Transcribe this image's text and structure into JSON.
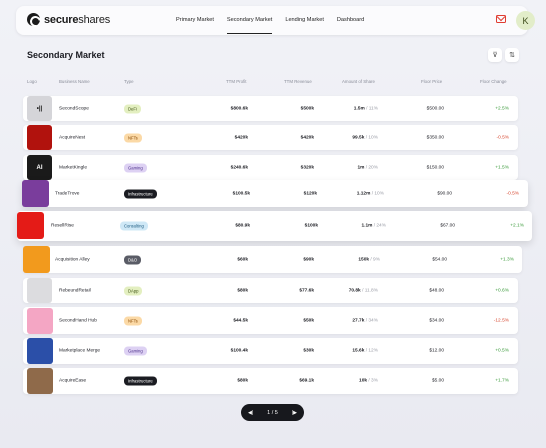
{
  "brand": {
    "name_bold": "secure",
    "name_rest": "shares"
  },
  "nav": {
    "items": [
      "Primary Market",
      "Secondary Market",
      "Lending Market",
      "Dashboard"
    ],
    "active": 1
  },
  "user": {
    "initial": "K"
  },
  "page": {
    "title": "Secondary Market"
  },
  "columns": [
    "Logo",
    "Business Name",
    "Type",
    "TTM Profit",
    "TTM Revenue",
    "Amount of Share",
    "Floor Price",
    "Floor Change"
  ],
  "rows": [
    {
      "name": "SecondScope",
      "type": "DeFi",
      "profit": "$800.6k",
      "revenue": "$500k",
      "shares": "1.5m",
      "shares_pct": "/ 11%",
      "price": "$500.00",
      "change": "+2.5%",
      "trend": "up",
      "badge_bg": "#e3efc0",
      "badge_fg": "#3e5212",
      "logo_bg": "#d5d5d9",
      "logo_icon": "text-mark",
      "logo_text": "•|| ",
      "logo_fg": "#111"
    },
    {
      "name": "AcquireNest",
      "type": "NFTs",
      "profit": "$420k",
      "revenue": "$420k",
      "shares": "99.5k",
      "shares_pct": "/ 10%",
      "price": "$350.00",
      "change": "-0.5%",
      "trend": "down",
      "badge_bg": "#fbd9a6",
      "badge_fg": "#8a4a05",
      "logo_bg": "#b1120d",
      "logo_icon": "red-swirl",
      "logo_text": "",
      "logo_fg": "#fff"
    },
    {
      "name": "MarketKingle",
      "type": "Gaming",
      "profit": "$240.6k",
      "revenue": "$320k",
      "shares": "1m",
      "shares_pct": "/ 20%",
      "price": "$150.00",
      "change": "+1.5%",
      "trend": "up",
      "badge_bg": "#ddd1f3",
      "badge_fg": "#4c2f8a",
      "logo_bg": "#1a1a1a",
      "logo_icon": "ai-mark",
      "logo_text": "AI",
      "logo_fg": "#fff"
    },
    {
      "name": "TradeTrove",
      "type": "Infrastructure",
      "profit": "$100.5k",
      "revenue": "$120k",
      "shares": "1.12m",
      "shares_pct": "/ 10%",
      "price": "$90.00",
      "change": "-0.5%",
      "trend": "down",
      "badge_bg": "#1b1c22",
      "badge_fg": "#ffffff",
      "logo_bg": "#7a3d9c",
      "logo_icon": "photo-mark",
      "logo_text": "",
      "logo_fg": "#fff"
    },
    {
      "name": "ResellRise",
      "type": "Consulting",
      "profit": "$80.9k",
      "revenue": "$100k",
      "shares": "1.1m",
      "shares_pct": "/ 24%",
      "price": "$67.00",
      "change": "+2.1%",
      "trend": "up",
      "badge_bg": "#cfe8f6",
      "badge_fg": "#1d5b80",
      "logo_bg": "#e41b17",
      "logo_icon": "flag-mark",
      "logo_text": "",
      "logo_fg": "#ffd800"
    },
    {
      "name": "Acquisition Alley",
      "type": "D&O",
      "profit": "$60k",
      "revenue": "$90k",
      "shares": "150k",
      "shares_pct": "/ 9%",
      "price": "$54.00",
      "change": "+1.3%",
      "trend": "up",
      "badge_bg": "#5a5c66",
      "badge_fg": "#ffffff",
      "logo_bg": "#f29a1d",
      "logo_icon": "orange-mark",
      "logo_text": "",
      "logo_fg": "#fff"
    },
    {
      "name": "RebeundRetail",
      "type": "DApp",
      "profit": "$80k",
      "revenue": "$77.6k",
      "shares": "70.8k",
      "shares_pct": "/ 11.8%",
      "price": "$48.00",
      "change": "+0.6%",
      "trend": "up",
      "badge_bg": "#e3efc0",
      "badge_fg": "#3e5212",
      "logo_bg": "#dcdcdf",
      "logo_icon": "wire-mark",
      "logo_text": "",
      "logo_fg": "#333"
    },
    {
      "name": "SecondHand Hub",
      "type": "NFTs",
      "profit": "$44.5k",
      "revenue": "$50k",
      "shares": "27.7k",
      "shares_pct": "/ 34%",
      "price": "$34.00",
      "change": "-12.5%",
      "trend": "down",
      "badge_bg": "#fbd9a6",
      "badge_fg": "#8a4a05",
      "logo_bg": "#f4a6c4",
      "logo_icon": "banana-mark",
      "logo_text": "",
      "logo_fg": "#e8b21a"
    },
    {
      "name": "Marketplace Merge",
      "type": "Gaming",
      "profit": "$100.4k",
      "revenue": "$30k",
      "shares": "15.6k",
      "shares_pct": "/ 12%",
      "price": "$12.00",
      "change": "+0.5%",
      "trend": "up",
      "badge_bg": "#ddd1f3",
      "badge_fg": "#4c2f8a",
      "logo_bg": "#2b4fa8",
      "logo_icon": "art-mark",
      "logo_text": "",
      "logo_fg": "#e88a2a"
    },
    {
      "name": "AcquireEase",
      "type": "Infrastructure",
      "profit": "$80k",
      "revenue": "$69.1k",
      "shares": "10k",
      "shares_pct": "/ 3%",
      "price": "$5.00",
      "change": "+1.7%",
      "trend": "up",
      "badge_bg": "#1b1c22",
      "badge_fg": "#ffffff",
      "logo_bg": "#8f6a4a",
      "logo_icon": "paint-mark",
      "logo_text": "",
      "logo_fg": "#d9b07a"
    }
  ],
  "pagination": {
    "label": "1 / 5"
  }
}
